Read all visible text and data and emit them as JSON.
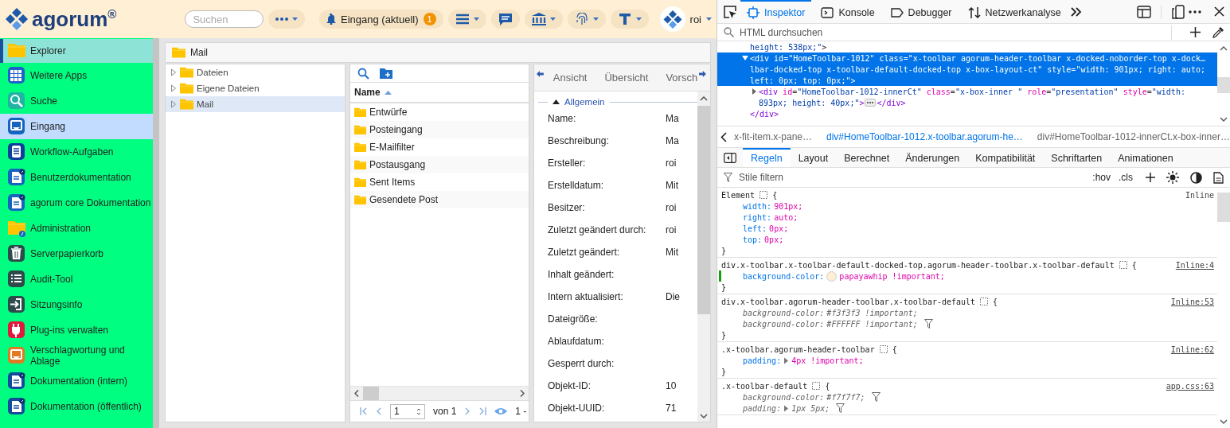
{
  "header": {
    "logo_text": "agorum$^{®}$",
    "search": {
      "placeholder": "Suchen"
    },
    "inbox_button": {
      "label": "Eingang (aktuell)",
      "badge": "1"
    },
    "toolbar_buttons": [
      {
        "kind": "menu",
        "dropdown": true
      },
      {
        "kind": "chat",
        "dropdown": false
      },
      {
        "kind": "bank",
        "dropdown": true
      },
      {
        "kind": "fingerprint",
        "dropdown": true
      },
      {
        "kind": "font",
        "dropdown": true
      }
    ],
    "user": {
      "name": "roi"
    }
  },
  "sidebar": {
    "items": [
      {
        "kind": "folder",
        "label": "Explorer",
        "selected": true,
        "highlighted": false
      },
      {
        "kind": "apps",
        "label": "Weitere Apps",
        "selected": false,
        "highlighted": false
      },
      {
        "kind": "search",
        "label": "Suche",
        "selected": false,
        "highlighted": false
      },
      {
        "kind": "inbox",
        "label": "Eingang",
        "selected": false,
        "highlighted": true
      },
      {
        "kind": "tasks",
        "label": "Workflow-Aufgaben",
        "selected": false,
        "highlighted": false
      },
      {
        "kind": "doc-link",
        "label": "Benutzerdokumentation",
        "selected": false,
        "highlighted": false
      },
      {
        "kind": "doc-link",
        "label": "agorum core Dokumentation",
        "selected": false,
        "highlighted": false
      },
      {
        "kind": "folder-admin",
        "label": "Administration",
        "selected": false,
        "highlighted": false
      },
      {
        "kind": "trash",
        "label": "Serverpapierkorb",
        "selected": false,
        "highlighted": false
      },
      {
        "kind": "list",
        "label": "Audit-Tool",
        "selected": false,
        "highlighted": false
      },
      {
        "kind": "session",
        "label": "Sitzungsinfo",
        "selected": false,
        "highlighted": false
      },
      {
        "kind": "plugin",
        "label": "Plug-ins verwalten",
        "selected": false,
        "highlighted": false
      },
      {
        "kind": "inbox-tag",
        "label": "Verschlagwortung und Ablage",
        "selected": false,
        "highlighted": false
      },
      {
        "kind": "doc-internal",
        "label": "Dokumentation (intern)",
        "selected": false,
        "highlighted": false
      },
      {
        "kind": "doc-public",
        "label": "Dokumentation (öffentlich)",
        "selected": false,
        "highlighted": false
      }
    ]
  },
  "explorer": {
    "breadcrumb": "Mail",
    "tree": [
      {
        "label": "Dateien",
        "selected": false,
        "expanded": false
      },
      {
        "label": "Eigene Dateien",
        "selected": false,
        "expanded": false
      },
      {
        "label": "Mail",
        "selected": true,
        "expanded": false
      }
    ],
    "list": {
      "column": {
        "label": "Name",
        "sorted_ascending": true
      },
      "rows": [
        "Entwürfe",
        "Posteingang",
        "E-Mailfilter",
        "Postausgang",
        "Sent Items",
        "Gesendete Post"
      ],
      "pager": {
        "page": "1",
        "of": "von 1",
        "range": "1 -"
      }
    },
    "detail": {
      "tabs": [
        "Ansicht",
        "Übersicht",
        "Vorsch"
      ],
      "section": {
        "title": "Allgemein",
        "expanded": true
      },
      "fields": [
        {
          "label": "Name:",
          "value": "Ma"
        },
        {
          "label": "Beschreibung:",
          "value": "Ma"
        },
        {
          "label": "Ersteller:",
          "value": "roi"
        },
        {
          "label": "Erstelldatum:",
          "value": "Mit"
        },
        {
          "label": "Besitzer:",
          "value": "roi"
        },
        {
          "label": "Zuletzt geändert durch:",
          "value": "roi"
        },
        {
          "label": "Zuletzt geändert:",
          "value": "Mit"
        },
        {
          "label": "Inhalt geändert:"
        },
        {
          "label": "Intern aktualisiert:",
          "value": "Die"
        },
        {
          "label": "Dateigröße:"
        },
        {
          "label": "Ablaufdatum:"
        },
        {
          "label": "Gesperrt durch:"
        },
        {
          "label": "Objekt-ID:",
          "value": "10"
        },
        {
          "label": "Objekt-UUID:",
          "value": "71"
        }
      ]
    }
  },
  "devtools": {
    "tabs": [
      {
        "kind": "inspector",
        "label": "Inspektor",
        "selected": true
      },
      {
        "kind": "console",
        "label": "Konsole",
        "selected": false
      },
      {
        "kind": "debugger",
        "label": "Debugger",
        "selected": false
      },
      {
        "kind": "network",
        "label": "Netzwerkanalyse",
        "selected": false
      }
    ],
    "search": {
      "placeholder": "HTML durchsuchen"
    },
    "markup": {
      "lead_lines": [
        [
          {
            "kind": "value",
            "text": "height: 538px;\""
          },
          {
            "kind": "punct",
            "text": ">"
          }
        ]
      ],
      "nodes": [
        {
          "selected": true,
          "expanded": true,
          "lines": [
            [
              {
                "text": "<div id=\"HomeToolbar-1012\" class=\"x-toolbar agorum-header-toolbar x-docked-noborder-top x-dock…"
              }
            ],
            [
              {
                "text": "lbar-docked-top x-toolbar-default-docked-top x-box-layout-ct\" style=\"width: 901px; right: auto;"
              }
            ],
            [
              {
                "text": "left: 0px; top: 0px;\">"
              }
            ]
          ],
          "children": [
            {
              "selected": false,
              "expanded": false,
              "lines": [
                [
                  {
                    "kind": "tag",
                    "text": "<div"
                  },
                  {
                    "kind": "attr",
                    "text": " id"
                  },
                  {
                    "kind": "punct",
                    "text": "="
                  },
                  {
                    "kind": "value",
                    "text": "\"HomeToolbar-1012-innerCt\""
                  },
                  {
                    "kind": "attr",
                    "text": " class"
                  },
                  {
                    "kind": "punct",
                    "text": "="
                  },
                  {
                    "kind": "value",
                    "text": "\"x-box-inner \""
                  },
                  {
                    "kind": "attr",
                    "text": " role"
                  },
                  {
                    "kind": "punct",
                    "text": "="
                  },
                  {
                    "kind": "value",
                    "text": "\"presentation\""
                  },
                  {
                    "kind": "attr",
                    "text": " style"
                  },
                  {
                    "kind": "punct",
                    "text": "="
                  },
                  {
                    "kind": "value",
                    "text": "\"width:"
                  }
                ],
                [
                  {
                    "kind": "value",
                    "text": "893px; height: 40px;\""
                  },
                  {
                    "kind": "tag",
                    "text": ">"
                  },
                  {
                    "kind": "ellipsis"
                  },
                  {
                    "kind": "tag",
                    "text": "</div>"
                  }
                ]
              ]
            }
          ],
          "closing": [
            {
              "kind": "tag",
              "text": "</div>"
            }
          ]
        }
      ]
    },
    "breadcrumbs": [
      {
        "label": "x-fit-item.x-pane…",
        "selected": false
      },
      {
        "label": "div#HomeToolbar-1012.x-toolbar.agorum-he…",
        "selected": true
      },
      {
        "label": "div#HomeToolbar-1012-innerCt.x-box-inner…",
        "selected": false
      }
    ],
    "panel_tabs": [
      {
        "label": "Regeln",
        "selected": true
      },
      {
        "label": "Layout",
        "selected": false
      },
      {
        "label": "Berechnet",
        "selected": false
      },
      {
        "label": "Änderungen",
        "selected": false
      },
      {
        "label": "Kompatibilität",
        "selected": false
      },
      {
        "label": "Schriftarten",
        "selected": false
      },
      {
        "label": "Animationen",
        "selected": false
      }
    ],
    "filter": {
      "placeholder": "Stile filtern",
      "buttons": [
        ":hov",
        ".cls"
      ]
    },
    "rules": [
      {
        "kind": "element",
        "selector": "Element",
        "open": "{",
        "close": "}",
        "source": "Inline",
        "declarations": [
          {
            "property": "width:",
            "value": "901px;",
            "overridden": false,
            "filtered": false,
            "changed": false,
            "expandable": false
          },
          {
            "property": "right:",
            "value": "auto;",
            "overridden": false,
            "filtered": false,
            "changed": false,
            "expandable": false
          },
          {
            "property": "left:",
            "value": "0px;",
            "overridden": false,
            "filtered": false,
            "changed": false,
            "expandable": false
          },
          {
            "property": "top:",
            "value": "0px;",
            "overridden": false,
            "filtered": false,
            "changed": false,
            "expandable": false
          }
        ]
      },
      {
        "kind": "rule",
        "selector": "div.x-toolbar.x-toolbar-default-docked-top.agorum-header-toolbar.x-toolbar-default",
        "open": "{",
        "close": "}",
        "source": "Inline:4",
        "declarations": [
          {
            "property": "background-color:",
            "value": "papayawhip !important;",
            "color": "#ffefd5",
            "overridden": false,
            "filtered": false,
            "changed": true,
            "expandable": false
          }
        ]
      },
      {
        "kind": "rule",
        "selector": "div.x-toolbar.agorum-header-toolbar.x-toolbar-default",
        "open": "{",
        "close": "}",
        "source": "Inline:53",
        "declarations": [
          {
            "property": "background-color:",
            "value": "#f3f3f3 !important;",
            "overridden": true,
            "filtered": false,
            "changed": false,
            "expandable": false
          },
          {
            "property": "background-color:",
            "value": "#FFFFFF !important;",
            "overridden": true,
            "filtered": true,
            "changed": false,
            "expandable": false
          }
        ]
      },
      {
        "kind": "rule",
        "selector": ".x-toolbar.agorum-header-toolbar",
        "open": "{",
        "close": "}",
        "source": "Inline:62",
        "declarations": [
          {
            "property": "padding:",
            "value": "4px !important;",
            "overridden": false,
            "filtered": false,
            "changed": false,
            "expandable": true
          }
        ]
      },
      {
        "kind": "rule",
        "selector": ".x-toolbar-default",
        "open": "{",
        "source": "app.css:63",
        "declarations": [
          {
            "property": "background-color:",
            "value": "#f7f7f7;",
            "overridden": true,
            "filtered": true,
            "changed": false,
            "expandable": false
          },
          {
            "property": "padding:",
            "value": "1px 5px;",
            "overridden": true,
            "filtered": true,
            "changed": false,
            "expandable": true
          }
        ]
      }
    ]
  }
}
